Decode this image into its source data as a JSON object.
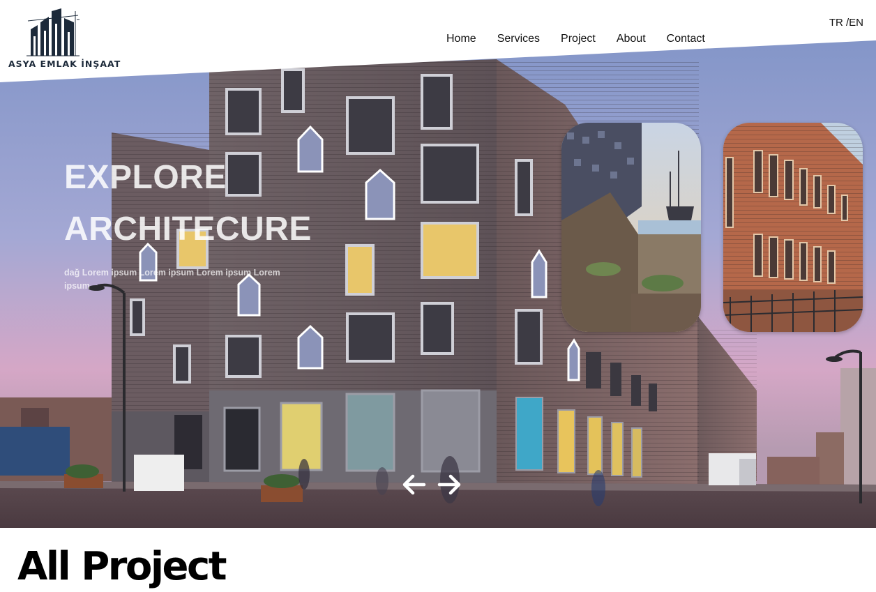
{
  "brand": {
    "logo_icon": "building-skyline-icon",
    "name": "ASYA EMLAK İNŞAAT"
  },
  "nav": {
    "items": [
      {
        "label": "Home"
      },
      {
        "label": "Services"
      },
      {
        "label": "Project"
      },
      {
        "label": "About"
      },
      {
        "label": "Contact"
      }
    ]
  },
  "language": {
    "tr": "TR",
    "separator": " /",
    "en": "EN"
  },
  "hero": {
    "image": "modern-brick-apartment-building-photo",
    "title_line1": "EXPLORE",
    "title_line2": "ARCHITECURE",
    "subtitle": "dağ Lorem ipsum Lorem ipsum Lorem ipsum Lorem ipsum",
    "cards": [
      {
        "image": "harbor-terrace-with-tall-ship-photo"
      },
      {
        "image": "red-brick-historic-facade-photo"
      }
    ],
    "prev_icon": "arrow-left-icon",
    "next_icon": "arrow-right-icon"
  },
  "section": {
    "title": "All Project"
  },
  "colors": {
    "header_bg": "#ffffff",
    "logo_navy": "#1d2a3a",
    "text_dark": "#111111",
    "hero_text": "#ffffff",
    "brick_gray": "#6a5c60",
    "window_glow": "#e8c66a"
  }
}
